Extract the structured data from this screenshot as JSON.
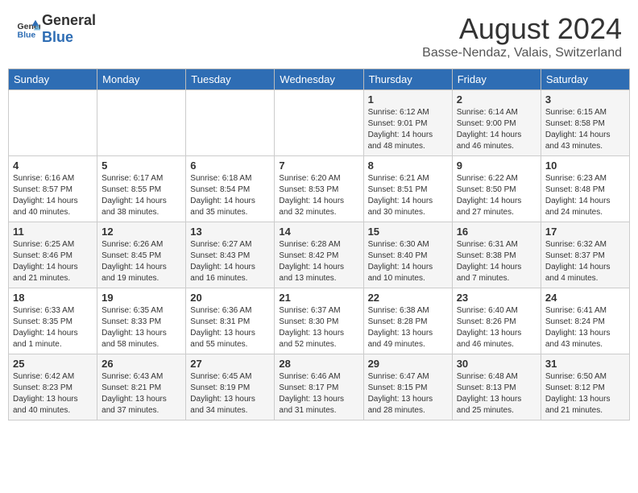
{
  "header": {
    "logo_general": "General",
    "logo_blue": "Blue",
    "month_year": "August 2024",
    "location": "Basse-Nendaz, Valais, Switzerland"
  },
  "weekdays": [
    "Sunday",
    "Monday",
    "Tuesday",
    "Wednesday",
    "Thursday",
    "Friday",
    "Saturday"
  ],
  "weeks": [
    [
      {
        "date": "",
        "info": ""
      },
      {
        "date": "",
        "info": ""
      },
      {
        "date": "",
        "info": ""
      },
      {
        "date": "",
        "info": ""
      },
      {
        "date": "1",
        "info": "Sunrise: 6:12 AM\nSunset: 9:01 PM\nDaylight: 14 hours\nand 48 minutes."
      },
      {
        "date": "2",
        "info": "Sunrise: 6:14 AM\nSunset: 9:00 PM\nDaylight: 14 hours\nand 46 minutes."
      },
      {
        "date": "3",
        "info": "Sunrise: 6:15 AM\nSunset: 8:58 PM\nDaylight: 14 hours\nand 43 minutes."
      }
    ],
    [
      {
        "date": "4",
        "info": "Sunrise: 6:16 AM\nSunset: 8:57 PM\nDaylight: 14 hours\nand 40 minutes."
      },
      {
        "date": "5",
        "info": "Sunrise: 6:17 AM\nSunset: 8:55 PM\nDaylight: 14 hours\nand 38 minutes."
      },
      {
        "date": "6",
        "info": "Sunrise: 6:18 AM\nSunset: 8:54 PM\nDaylight: 14 hours\nand 35 minutes."
      },
      {
        "date": "7",
        "info": "Sunrise: 6:20 AM\nSunset: 8:53 PM\nDaylight: 14 hours\nand 32 minutes."
      },
      {
        "date": "8",
        "info": "Sunrise: 6:21 AM\nSunset: 8:51 PM\nDaylight: 14 hours\nand 30 minutes."
      },
      {
        "date": "9",
        "info": "Sunrise: 6:22 AM\nSunset: 8:50 PM\nDaylight: 14 hours\nand 27 minutes."
      },
      {
        "date": "10",
        "info": "Sunrise: 6:23 AM\nSunset: 8:48 PM\nDaylight: 14 hours\nand 24 minutes."
      }
    ],
    [
      {
        "date": "11",
        "info": "Sunrise: 6:25 AM\nSunset: 8:46 PM\nDaylight: 14 hours\nand 21 minutes."
      },
      {
        "date": "12",
        "info": "Sunrise: 6:26 AM\nSunset: 8:45 PM\nDaylight: 14 hours\nand 19 minutes."
      },
      {
        "date": "13",
        "info": "Sunrise: 6:27 AM\nSunset: 8:43 PM\nDaylight: 14 hours\nand 16 minutes."
      },
      {
        "date": "14",
        "info": "Sunrise: 6:28 AM\nSunset: 8:42 PM\nDaylight: 14 hours\nand 13 minutes."
      },
      {
        "date": "15",
        "info": "Sunrise: 6:30 AM\nSunset: 8:40 PM\nDaylight: 14 hours\nand 10 minutes."
      },
      {
        "date": "16",
        "info": "Sunrise: 6:31 AM\nSunset: 8:38 PM\nDaylight: 14 hours\nand 7 minutes."
      },
      {
        "date": "17",
        "info": "Sunrise: 6:32 AM\nSunset: 8:37 PM\nDaylight: 14 hours\nand 4 minutes."
      }
    ],
    [
      {
        "date": "18",
        "info": "Sunrise: 6:33 AM\nSunset: 8:35 PM\nDaylight: 14 hours\nand 1 minute."
      },
      {
        "date": "19",
        "info": "Sunrise: 6:35 AM\nSunset: 8:33 PM\nDaylight: 13 hours\nand 58 minutes."
      },
      {
        "date": "20",
        "info": "Sunrise: 6:36 AM\nSunset: 8:31 PM\nDaylight: 13 hours\nand 55 minutes."
      },
      {
        "date": "21",
        "info": "Sunrise: 6:37 AM\nSunset: 8:30 PM\nDaylight: 13 hours\nand 52 minutes."
      },
      {
        "date": "22",
        "info": "Sunrise: 6:38 AM\nSunset: 8:28 PM\nDaylight: 13 hours\nand 49 minutes."
      },
      {
        "date": "23",
        "info": "Sunrise: 6:40 AM\nSunset: 8:26 PM\nDaylight: 13 hours\nand 46 minutes."
      },
      {
        "date": "24",
        "info": "Sunrise: 6:41 AM\nSunset: 8:24 PM\nDaylight: 13 hours\nand 43 minutes."
      }
    ],
    [
      {
        "date": "25",
        "info": "Sunrise: 6:42 AM\nSunset: 8:23 PM\nDaylight: 13 hours\nand 40 minutes."
      },
      {
        "date": "26",
        "info": "Sunrise: 6:43 AM\nSunset: 8:21 PM\nDaylight: 13 hours\nand 37 minutes."
      },
      {
        "date": "27",
        "info": "Sunrise: 6:45 AM\nSunset: 8:19 PM\nDaylight: 13 hours\nand 34 minutes."
      },
      {
        "date": "28",
        "info": "Sunrise: 6:46 AM\nSunset: 8:17 PM\nDaylight: 13 hours\nand 31 minutes."
      },
      {
        "date": "29",
        "info": "Sunrise: 6:47 AM\nSunset: 8:15 PM\nDaylight: 13 hours\nand 28 minutes."
      },
      {
        "date": "30",
        "info": "Sunrise: 6:48 AM\nSunset: 8:13 PM\nDaylight: 13 hours\nand 25 minutes."
      },
      {
        "date": "31",
        "info": "Sunrise: 6:50 AM\nSunset: 8:12 PM\nDaylight: 13 hours\nand 21 minutes."
      }
    ]
  ]
}
